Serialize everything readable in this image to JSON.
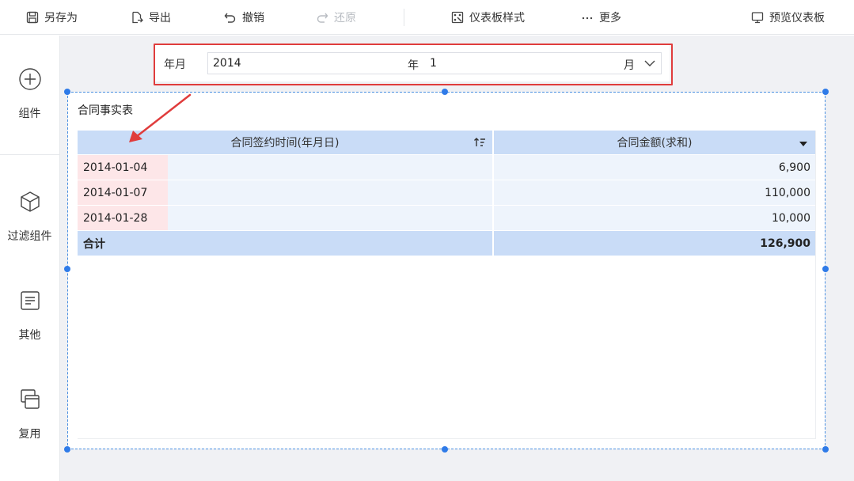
{
  "toolbar": {
    "save_as": "另存为",
    "export": "导出",
    "undo": "撤销",
    "redo": "还原",
    "dashboard_style": "仪表板样式",
    "more": "更多",
    "preview": "预览仪表板"
  },
  "sidebar": {
    "items": [
      {
        "label": "组件",
        "icon": "plus-circle-icon"
      },
      {
        "label": "过滤组件",
        "icon": "cube-icon"
      },
      {
        "label": "其他",
        "icon": "document-icon"
      },
      {
        "label": "复用",
        "icon": "copy-windows-icon"
      }
    ]
  },
  "filter": {
    "label": "年月",
    "year_value": "2014",
    "year_unit": "年",
    "month_value": "1",
    "month_unit": "月"
  },
  "widget": {
    "title": "合同事实表",
    "columns": [
      "合同签约时间(年月日)",
      "合同金额(求和)"
    ],
    "rows": [
      {
        "date": "2014-01-04",
        "amount": "6,900"
      },
      {
        "date": "2014-01-07",
        "amount": "110,000"
      },
      {
        "date": "2014-01-28",
        "amount": "10,000"
      }
    ],
    "total_label": "合计",
    "total_amount": "126,900"
  },
  "colors": {
    "accent": "#2f7be8",
    "header_bg": "#c9dcf7",
    "row_bg": "#eef4fc",
    "date_cell_bg": "#fde6e8",
    "annotation_red": "#e03c3c"
  }
}
